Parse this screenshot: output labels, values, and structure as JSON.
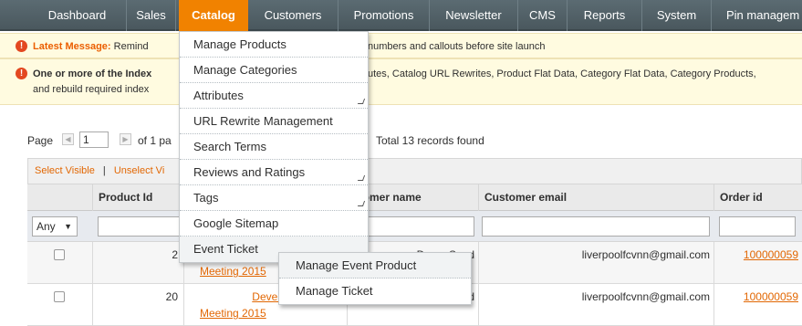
{
  "nav": {
    "items": [
      "Dashboard",
      "Sales",
      "Catalog",
      "Customers",
      "Promotions",
      "Newsletter",
      "CMS",
      "Reports",
      "System",
      "Pin managem"
    ],
    "active": "Catalog"
  },
  "messages": {
    "latest_label": "Latest Message:",
    "latest_text_left": "Remind",
    "latest_text_right": "numbers and callouts before site launch",
    "index_label": "One or more of the Index",
    "index_text_right": "utes, Catalog URL Rewrites, Product Flat Data, Category Flat Data, Category Products,",
    "index_line2": "and rebuild required index"
  },
  "pager": {
    "page_label": "Page",
    "page_value": "1",
    "of_pages": "of 1 pa",
    "total": "Total 13 records found"
  },
  "massaction": {
    "select_visible": "Select Visible",
    "separator": "|",
    "unselect": "Unselect Vi"
  },
  "grid": {
    "headers": [
      "Product Id",
      "stomer name",
      "Customer email",
      "Order id"
    ],
    "filter_any": "Any",
    "rows": [
      {
        "id": "2",
        "product_line1": "",
        "product_line2": "Meeting 2015",
        "customer": "Demo Send",
        "email": "liverpoolfcvnn@gmail.com",
        "order": "100000059"
      },
      {
        "id": "20",
        "product_line1": "Developer",
        "product_line2": "Meeting 2015",
        "customer": "d",
        "email": "liverpoolfcvnn@gmail.com",
        "order": "100000059"
      }
    ]
  },
  "catalog_menu": {
    "items": [
      "Manage Products",
      "Manage Categories",
      "Attributes",
      "URL Rewrite Management",
      "Search Terms",
      "Reviews and Ratings",
      "Tags",
      "Google Sitemap",
      "Event Ticket"
    ]
  },
  "event_submenu": {
    "items": [
      "Manage Event Product",
      "Manage Ticket"
    ]
  },
  "colors": {
    "accent": "#f18200",
    "nav_bg": "#4f5d63",
    "link": "#e26703"
  }
}
